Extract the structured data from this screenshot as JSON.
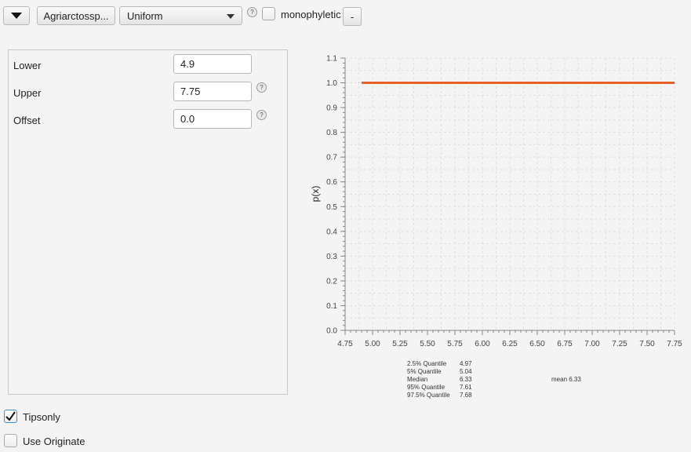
{
  "toolbar": {
    "taxon_button": "Agriarctossp...",
    "distribution_select": "Uniform",
    "monophyletic_label": "monophyletic",
    "minus_button": "-",
    "help_glyph": "?"
  },
  "params": [
    {
      "label": "Lower",
      "value": "4.9"
    },
    {
      "label": "Upper",
      "value": "7.75"
    },
    {
      "label": "Offset",
      "value": "0.0"
    }
  ],
  "checkboxes": {
    "tipsonly": {
      "label": "Tipsonly",
      "checked": true
    },
    "use_originate": {
      "label": "Use Originate",
      "checked": false
    }
  },
  "chart_data": {
    "type": "line",
    "ylabel": "p(x)",
    "xlabel": "",
    "xlim": [
      4.75,
      7.75
    ],
    "ylim": [
      0.0,
      1.1
    ],
    "xticks": [
      "4.75",
      "5.00",
      "5.25",
      "5.50",
      "5.75",
      "6.00",
      "6.25",
      "6.50",
      "6.75",
      "7.00",
      "7.25",
      "7.50",
      "7.75"
    ],
    "yticks": [
      "0.0",
      "0.1",
      "0.2",
      "0.3",
      "0.4",
      "0.5",
      "0.6",
      "0.7",
      "0.8",
      "0.9",
      "1.0",
      "1.1"
    ],
    "series": [
      {
        "color": "#e8602c",
        "x": [
          4.9,
          7.75
        ],
        "y": [
          1.0,
          1.0
        ]
      }
    ],
    "grid": true
  },
  "stats": [
    {
      "label": "2.5% Quantile",
      "value": "4.97"
    },
    {
      "label": "5% Quantile",
      "value": "5.04"
    },
    {
      "label": "Median",
      "value": "6.33"
    },
    {
      "label": "95% Quantile",
      "value": "7.61"
    },
    {
      "label": "97.5% Quantile",
      "value": "7.68"
    }
  ],
  "mean_text": "mean 6.33"
}
